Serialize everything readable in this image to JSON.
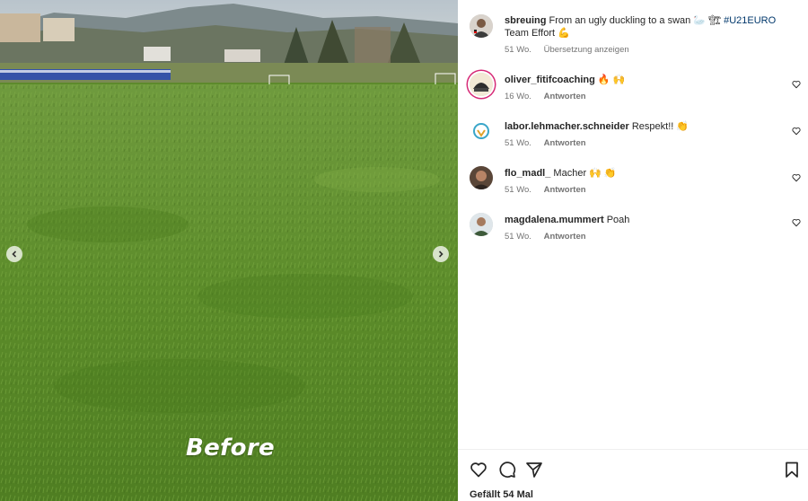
{
  "media": {
    "overlay_text": "Before"
  },
  "caption": {
    "username": "sbreuing",
    "text": "From an ugly duckling to a swan 🦢 🏗",
    "hashtag": "#U21EURO",
    "text_after": "Team Effort 💪",
    "time": "51 Wo.",
    "translate_label": "Übersetzung anzeigen"
  },
  "comments": [
    {
      "username": "oliver_fitifcoaching",
      "text": "🔥 🙌",
      "time": "16 Wo.",
      "reply_label": "Antworten"
    },
    {
      "username": "labor.lehmacher.schneider",
      "text": "Respekt!! 👏",
      "time": "51 Wo.",
      "reply_label": "Antworten"
    },
    {
      "username": "flo_madl_",
      "text": "Macher 🙌 👏",
      "time": "51 Wo.",
      "reply_label": "Antworten"
    },
    {
      "username": "magdalena.mummert",
      "text": "Poah",
      "time": "51 Wo.",
      "reply_label": "Antworten"
    }
  ],
  "footer": {
    "likes_label": "Gefällt 54 Mal"
  },
  "icons": {
    "prev": "chevron-left-icon",
    "next": "chevron-right-icon",
    "like": "heart-icon",
    "comment": "comment-icon",
    "share": "send-icon",
    "save": "bookmark-icon"
  },
  "colors": {
    "grass": "#5d8a2c",
    "link": "#00376b",
    "meta": "#737373",
    "story_ring": "#d62976"
  }
}
